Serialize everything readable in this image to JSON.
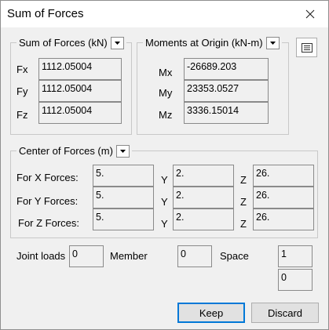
{
  "window": {
    "title": "Sum of Forces"
  },
  "forces": {
    "header": "Sum of Forces (kN)",
    "rows": [
      {
        "label": "Fx",
        "value": "1112.05004"
      },
      {
        "label": "Fy",
        "value": "1112.05004"
      },
      {
        "label": "Fz",
        "value": "1112.05004"
      }
    ]
  },
  "moments": {
    "header": "Moments at Origin (kN-m)",
    "rows": [
      {
        "label": "Mx",
        "value": "-26689.203"
      },
      {
        "label": "My",
        "value": "23353.0527"
      },
      {
        "label": "Mz",
        "value": "3336.15014"
      }
    ]
  },
  "center": {
    "header": "Center of Forces (m)",
    "rows": [
      {
        "label": "For X Forces:",
        "x": "5.",
        "y_label": "Y",
        "y": "2.",
        "z_label": "Z",
        "z": "26."
      },
      {
        "label": "For Y Forces:",
        "x": "5.",
        "y_label": "Y",
        "y": "2.",
        "z_label": "Z",
        "z": "26."
      },
      {
        "label": "For Z Forces:",
        "x": "5.",
        "y_label": "Y",
        "y": "2.",
        "z_label": "Z",
        "z": "26."
      }
    ]
  },
  "bottom": {
    "joint_loads_label": "Joint loads",
    "joint_loads_value": "0",
    "member_label": "Member",
    "member_value": "0",
    "space_label": "Space",
    "space_value_1": "1",
    "space_value_2": "0"
  },
  "buttons": {
    "keep": "Keep",
    "discard": "Discard"
  }
}
